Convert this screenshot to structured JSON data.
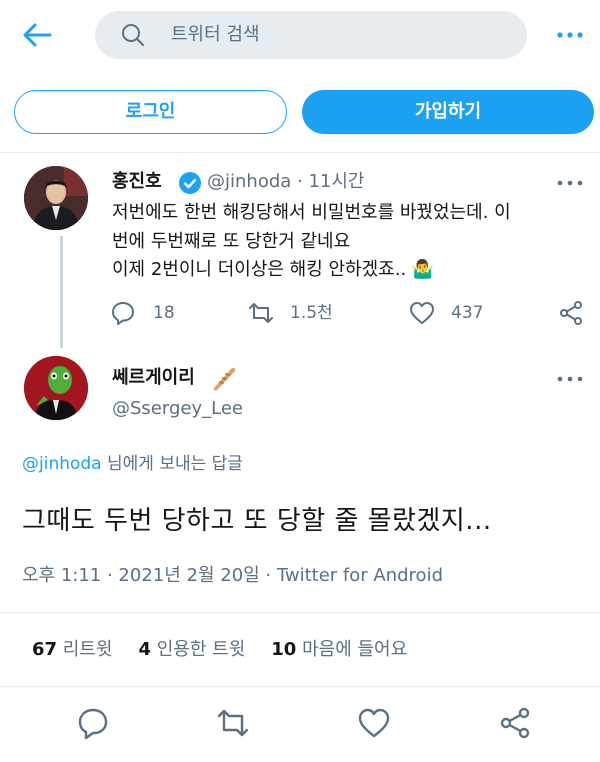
{
  "header": {
    "back_icon": "arrow-left-icon",
    "search_placeholder": "트위터 검색",
    "more_icon": "more-dots-icon",
    "accent_color": "#1da1f2"
  },
  "auth": {
    "login_label": "로그인",
    "signup_label": "가입하기"
  },
  "tweet1": {
    "name": "홍진호",
    "verified": true,
    "handle_time": "@jinhoda · 11시간",
    "lines": [
      "저번에도 한번 해킹당해서 비밀번호를 바꿨었는데. 이",
      "번에 두번째로 또 당한거 같네요",
      "이제 2번이니 더이상은 해킹 안하겠죠.. 🤷‍♂️"
    ],
    "actions": {
      "reply_count": "18",
      "retweet_count": "1.5천",
      "like_count": "437"
    }
  },
  "tweet2": {
    "name": "쎄르게이리",
    "handle": "@Ssergey_Lee",
    "reply_to_handle": "@jinhoda",
    "reply_to_suffix": " 님에게 보내는 답글",
    "text": "그때도 두번 당하고 또 당할 줄 몰랐겠지...",
    "meta": "오후 1:11 · 2021년 2월 20일 · Twitter for Android",
    "stats": {
      "retweets_count": "67",
      "retweets_label": "리트윗",
      "quotes_count": "4",
      "quotes_label": "인용한 트윗",
      "likes_count": "10",
      "likes_label": "마음에 들어요"
    }
  }
}
